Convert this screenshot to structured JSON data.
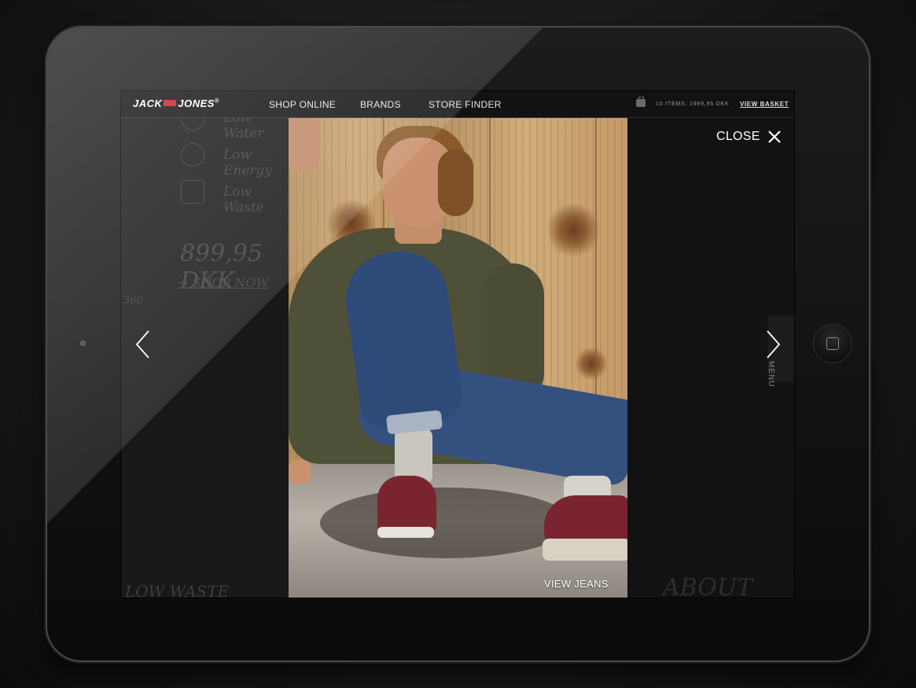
{
  "header": {
    "logo": {
      "left": "JACK",
      "right": "JONES",
      "trademark": "®"
    },
    "nav": [
      "SHOP ONLINE",
      "BRANDS",
      "STORE FINDER"
    ],
    "basket_summary": "10 ITEMS: 1999,95 DKK",
    "view_basket": "VIEW BASKET"
  },
  "background_page": {
    "features": [
      "Low Water",
      "Low Energy",
      "Low Waste"
    ],
    "price": "899,95 DKK",
    "shop_now": "→ SHOP NOW",
    "scale_label": "360",
    "bottom_left": "LOW WASTE",
    "bottom_right": "ABOUT LOW"
  },
  "lightbox": {
    "close_label": "CLOSE",
    "caption_link": "VIEW JEANS",
    "side_tab": "MENU"
  },
  "icons": {
    "close": "close-icon",
    "prev": "chevron-left-icon",
    "next": "chevron-right-icon",
    "basket": "shopping-bag-icon"
  },
  "colors": {
    "brand_red": "#c8202a",
    "background": "#0f0f0f",
    "text": "#ffffff"
  }
}
